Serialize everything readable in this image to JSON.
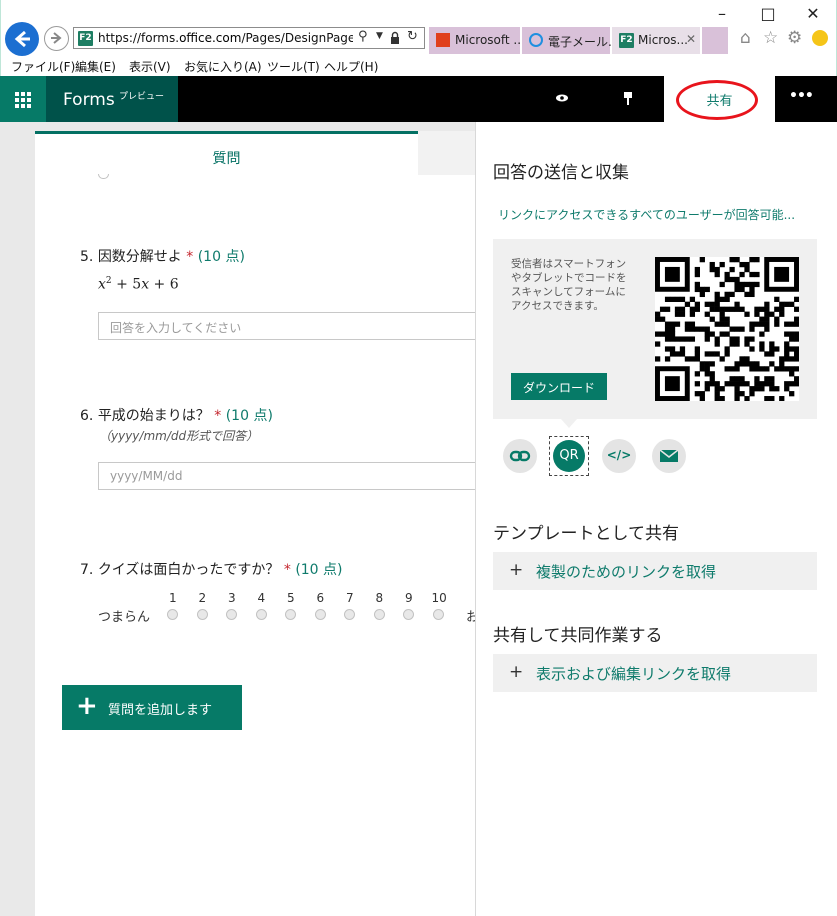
{
  "browser": {
    "url_prefix": "https://forms.",
    "url_domain": "office.com",
    "url_rest": "/Pages/DesignPage.aspx",
    "tabs": [
      {
        "label": "Microsoft ..."
      },
      {
        "label": "電子メール..."
      },
      {
        "label": "Micros..."
      }
    ],
    "menu": [
      "ファイル(F)",
      "編集(E)",
      "表示(V)",
      "お気に入り(A)",
      "ツール(T)",
      "ヘルプ(H)"
    ],
    "icons": [
      "back-icon",
      "forward-icon",
      "search-icon",
      "lock-icon",
      "refresh-icon",
      "home-icon",
      "star-icon",
      "gear-icon",
      "smiley-icon"
    ]
  },
  "app": {
    "brand": "Forms",
    "brand_sub": "プレビュー",
    "share_tab": "共有",
    "more": "•••"
  },
  "form": {
    "tab_label": "質問",
    "q5": {
      "num": "5.",
      "title": "因数分解せよ",
      "req": "*",
      "points": "(10 点)",
      "placeholder": "回答を入力してください"
    },
    "q6": {
      "num": "6.",
      "title": "平成の始まりは？",
      "req": "*",
      "points": "(10 点)",
      "subtitle": "（yyyy/mm/dd形式で回答）",
      "placeholder": "yyyy/MM/dd"
    },
    "q7": {
      "num": "7.",
      "title": "クイズは面白かったですか？",
      "req": "*",
      "points": "(10 点)",
      "low_label": "つまらん",
      "high_label_partial": "お",
      "scale": [
        "1",
        "2",
        "3",
        "4",
        "5",
        "6",
        "7",
        "8",
        "9",
        "10"
      ]
    },
    "add_question": "質問を追加します"
  },
  "share_panel": {
    "title": "回答の送信と収集",
    "access_link": "リンクにアクセスできるすべてのユーザーが回答可能...",
    "qr_desc": "受信者はスマートフォンやタブレットでコードをスキャンしてフォームにアクセスできます。",
    "download": "ダウンロード",
    "qr_button": "QR",
    "embed_label": "</>",
    "template_title": "テンプレートとして共有",
    "template_link": "複製のためのリンクを取得",
    "collab_title": "共有して共同作業する",
    "collab_link": "表示および編集リンクを取得",
    "plus": "+"
  },
  "colors": {
    "accent": "#037063",
    "brand_bg": "#00524a",
    "required": "#c4262e",
    "annotation_circle": "#e8141c"
  }
}
